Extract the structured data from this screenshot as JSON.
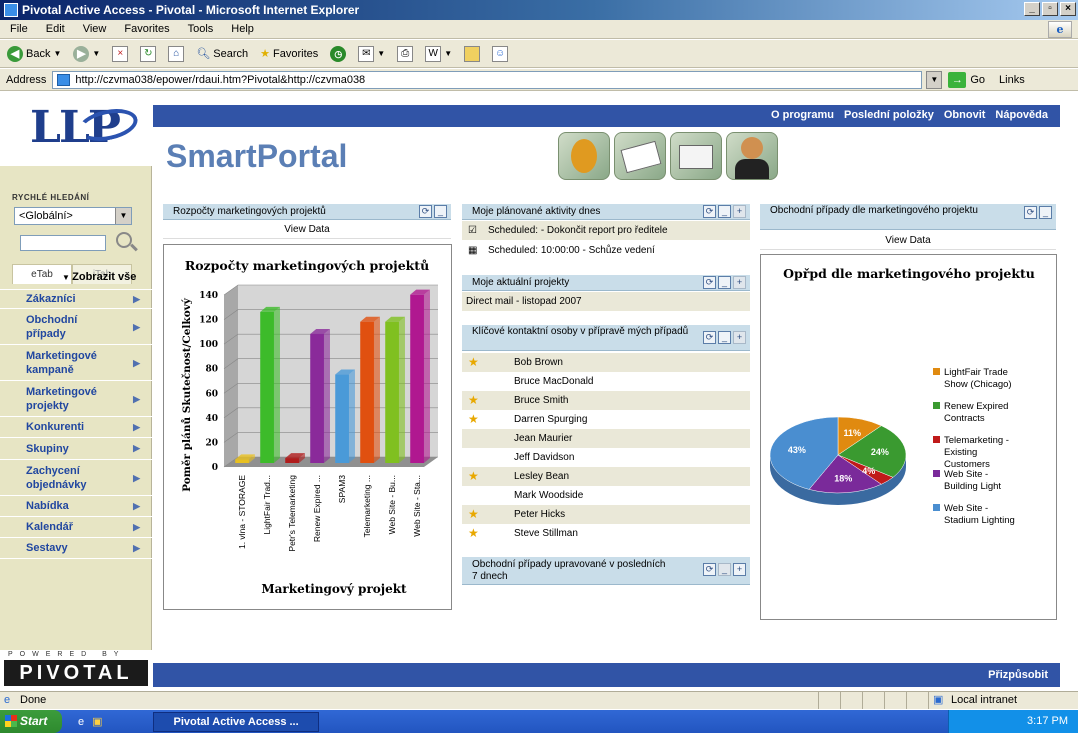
{
  "window": {
    "title": "Pivotal Active Access - Pivotal - Microsoft Internet Explorer"
  },
  "menu": [
    "File",
    "Edit",
    "View",
    "Favorites",
    "Tools",
    "Help"
  ],
  "toolbar": {
    "back": "Back",
    "search": "Search",
    "favorites": "Favorites"
  },
  "address": {
    "label": "Address",
    "url": "http://czvma038/epower/rdaui.htm?Pivotal&http://czvma038",
    "go": "Go",
    "links": "Links"
  },
  "brand": {
    "logo": "LLP",
    "title": "SmartPortal",
    "powered": "POWERED BY",
    "pivotal": "PIVOTAL"
  },
  "toplinks": [
    "O programu",
    "Poslední položky",
    "Obnovit",
    "Nápověda"
  ],
  "bottombar": {
    "customize": "Přizpůsobit"
  },
  "sidebar": {
    "tabs": [
      "eTab",
      "iTab"
    ],
    "quick_search": "RYCHLÉ HLEDÁNÍ",
    "scope": "<Globální>",
    "show_all": "Zobrazit vše",
    "items": [
      "Zákazníci",
      "Obchodní případy",
      "Marketingové kampaně",
      "Marketingové projekty",
      "Konkurenti",
      "Skupiny",
      "Zachycení objednávky",
      "Nabídka",
      "Kalendář",
      "Sestavy"
    ]
  },
  "panel1": {
    "title": "Rozpočty marketingových projektů",
    "view": "View Data"
  },
  "chart_data": [
    {
      "type": "bar",
      "title": "Rozpočty marketingových projektů",
      "xlabel": "Marketingový projekt",
      "ylabel": "Poměr plánů Skutečnost/Celkový",
      "ylim": [
        0,
        140
      ],
      "yticks": [
        0,
        20,
        40,
        60,
        80,
        100,
        120,
        140
      ],
      "categories": [
        "1. vlna - STORAGE",
        "LightFair Trad...",
        "Petr's Telemarketing",
        "Renew Expired ...",
        "SPAM3",
        "Telemarketing ...",
        "Web Site - Bu...",
        "Web Site - Sta..."
      ],
      "values": [
        3,
        123,
        4,
        105,
        72,
        115,
        115,
        137
      ],
      "colors": [
        "#e8c020",
        "#3dbb2a",
        "#b01c1c",
        "#8a2a9a",
        "#4a9ad8",
        "#e05010",
        "#80c020",
        "#b01890"
      ]
    },
    {
      "type": "pie",
      "title": "Opřpd dle marketingového projektu",
      "labels": [
        "LightFair Trade Show (Chicago)",
        "Renew Expired Contracts",
        "Telemarketing - Existing Customers",
        "Web Site - Building Light",
        "Web Site - Stadium Lighting"
      ],
      "values": [
        11,
        24,
        4,
        18,
        43
      ],
      "colors": [
        "#e08a10",
        "#3a9a30",
        "#c01a1a",
        "#7a2a9a",
        "#4a8ed0"
      ],
      "legend": "right"
    }
  ],
  "panel2": {
    "title": "Moje plánované aktivity dnes",
    "rows": [
      "Scheduled: - Dokončit report pro ředitele",
      "Scheduled: 10:00:00 - Schůze vedení"
    ]
  },
  "panel3": {
    "title": "Moje aktuální projekty",
    "rows": [
      "Direct mail - listopad 2007"
    ]
  },
  "panel4": {
    "title": "Klíčové kontaktní osoby v přípravě mých případů",
    "contacts": [
      {
        "name": "Bob Brown",
        "star": true
      },
      {
        "name": "Bruce MacDonald",
        "star": false
      },
      {
        "name": "Bruce Smith",
        "star": true
      },
      {
        "name": "Darren Spurging",
        "star": true
      },
      {
        "name": "Jean Maurier",
        "star": false
      },
      {
        "name": "Jeff Davidson",
        "star": false
      },
      {
        "name": "Lesley Bean",
        "star": true
      },
      {
        "name": "Mark Woodside",
        "star": false
      },
      {
        "name": "Peter Hicks",
        "star": true
      },
      {
        "name": "Steve Stillman",
        "star": true
      }
    ]
  },
  "panel5": {
    "title": "Obchodní případy upravované v posledních 7 dnech"
  },
  "panel6": {
    "title": "Obchodní případy dle marketingového projektu",
    "view": "View Data"
  },
  "status": {
    "text": "Done",
    "zone": "Local intranet"
  },
  "taskbar": {
    "start": "Start",
    "task": "Pivotal Active Access ...",
    "time": "3:17 PM"
  }
}
